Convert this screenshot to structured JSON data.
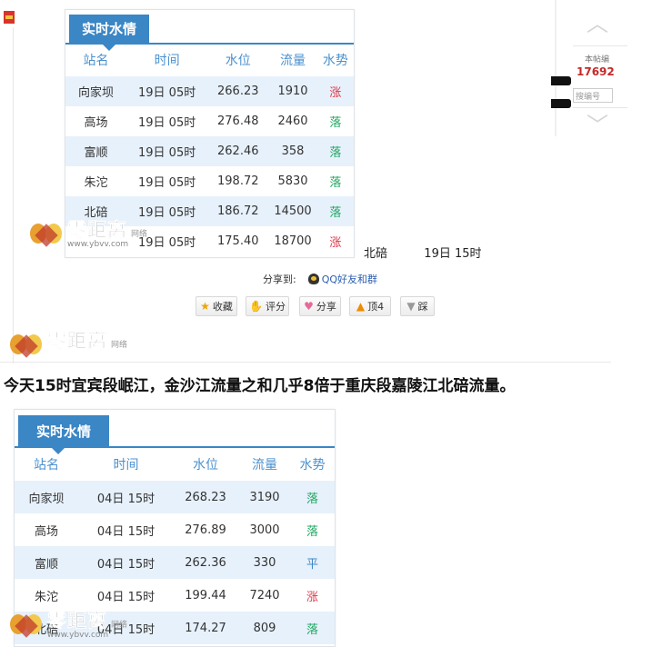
{
  "panel_top": {
    "tab": "实时水情",
    "headers": [
      "站名",
      "时间",
      "水位",
      "流量",
      "水势"
    ],
    "rows": [
      {
        "station": "向家坝",
        "time": "19日 05时",
        "level": "266.23",
        "flow": "1910",
        "trend": "涨"
      },
      {
        "station": "高场",
        "time": "19日 05时",
        "level": "276.48",
        "flow": "2460",
        "trend": "落"
      },
      {
        "station": "富顺",
        "time": "19日 05时",
        "level": "262.46",
        "flow": "358",
        "trend": "落"
      },
      {
        "station": "朱沱",
        "time": "19日 05时",
        "level": "198.72",
        "flow": "5830",
        "trend": "落"
      },
      {
        "station": "北碚",
        "time": "19日 05时",
        "level": "186.72",
        "flow": "14500",
        "trend": "落"
      },
      {
        "station": "",
        "time": "19日 05时",
        "level": "175.40",
        "flow": "18700",
        "trend": "涨"
      }
    ],
    "overflow_text": {
      "station": "北碚",
      "time": "19日 15时"
    }
  },
  "share": {
    "label": "分享到:",
    "qq": "QQ好友和群",
    "actions": [
      {
        "label": "收藏",
        "icon": "star-icon"
      },
      {
        "label": "评分",
        "icon": "thumb-icon"
      },
      {
        "label": "分享",
        "icon": "heart-icon"
      },
      {
        "label": "顶4",
        "icon": "up-arrow-icon"
      },
      {
        "label": "踩",
        "icon": "down-arrow-icon"
      }
    ]
  },
  "widget": {
    "label": "本帖编",
    "count": "17692",
    "search_placeholder": "搜编号"
  },
  "watermark": {
    "text": "零距离",
    "sub": "网络",
    "url": "www.ybvv.com"
  },
  "headline": "今天15时宜宾段岷江，金沙江流量之和几乎8倍于重庆段嘉陵江北碚流量。",
  "panel_bottom": {
    "tab": "实时水情",
    "headers": [
      "站名",
      "时间",
      "水位",
      "流量",
      "水势"
    ],
    "rows": [
      {
        "station": "向家坝",
        "time": "04日 15时",
        "level": "268.23",
        "flow": "3190",
        "trend": "落"
      },
      {
        "station": "高场",
        "time": "04日 15时",
        "level": "276.89",
        "flow": "3000",
        "trend": "落"
      },
      {
        "station": "富顺",
        "time": "04日 15时",
        "level": "262.36",
        "flow": "330",
        "trend": "平"
      },
      {
        "station": "朱沱",
        "time": "04日 15时",
        "level": "199.44",
        "flow": "7240",
        "trend": "涨"
      },
      {
        "station": "北碚",
        "time": "04日 15时",
        "level": "174.27",
        "flow": "809",
        "trend": "落"
      }
    ]
  },
  "colors": {
    "accent": "#3b86c5",
    "rise": "#e0394a",
    "fall": "#1ea660",
    "row_alt": "#e7f1fb"
  }
}
